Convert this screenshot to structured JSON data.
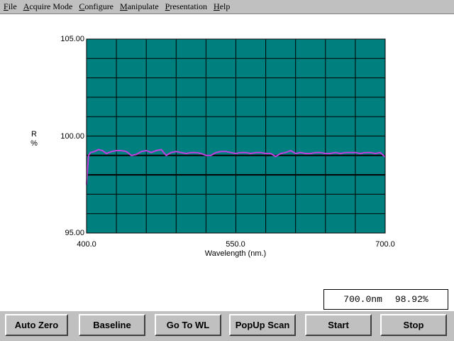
{
  "menu": {
    "items": [
      {
        "acc": "F",
        "rest": "ile"
      },
      {
        "acc": "A",
        "rest": "cquire Mode"
      },
      {
        "acc": "C",
        "rest": "onfigure"
      },
      {
        "acc": "M",
        "rest": "anipulate"
      },
      {
        "acc": "P",
        "rest": "resentation"
      },
      {
        "acc": "H",
        "rest": "elp"
      }
    ]
  },
  "readout": {
    "wavelength": "700.0nm",
    "value": "98.92%"
  },
  "buttons": [
    "Auto Zero",
    "Baseline",
    "Go To WL",
    "PopUp Scan",
    "Start",
    "Stop"
  ],
  "colors": {
    "plot_bg": "#007f7f",
    "grid": "#000000",
    "trace": "#c040e0",
    "button_face": "#c0c0c0"
  },
  "chart_data": {
    "type": "line",
    "xlabel": "Wavelength (nm.)",
    "ylabel": "R\n%",
    "xlim": [
      400,
      700
    ],
    "ylim": [
      95,
      105
    ],
    "x_tick_labels": [
      "400.0",
      "550.0",
      "700.0"
    ],
    "y_tick_labels": [
      "105.00",
      "100.00",
      "95.00"
    ],
    "grid": true,
    "grid_divisions": {
      "x": 10,
      "y": 10
    },
    "reference_lines": [
      99,
      98
    ],
    "series": [
      {
        "x": [
          400,
          401,
          402,
          404,
          408,
          412,
          416,
          420,
          425,
          430,
          435,
          440,
          445,
          450,
          455,
          460,
          465,
          470,
          475,
          480,
          485,
          490,
          495,
          500,
          505,
          510,
          515,
          520,
          525,
          530,
          535,
          540,
          545,
          550,
          555,
          560,
          565,
          570,
          575,
          580,
          585,
          590,
          595,
          600,
          605,
          610,
          615,
          620,
          625,
          630,
          635,
          640,
          645,
          650,
          655,
          660,
          665,
          670,
          675,
          680,
          685,
          690,
          695,
          700
        ],
        "values": [
          97.5,
          98.3,
          99.0,
          99.15,
          99.2,
          99.3,
          99.25,
          99.1,
          99.2,
          99.25,
          99.25,
          99.2,
          99.0,
          99.05,
          99.2,
          99.25,
          99.15,
          99.25,
          99.3,
          99.0,
          99.15,
          99.2,
          99.15,
          99.1,
          99.15,
          99.15,
          99.1,
          99.0,
          99.0,
          99.15,
          99.2,
          99.2,
          99.15,
          99.1,
          99.15,
          99.15,
          99.1,
          99.15,
          99.15,
          99.1,
          99.1,
          98.95,
          99.1,
          99.15,
          99.25,
          99.1,
          99.15,
          99.1,
          99.1,
          99.15,
          99.15,
          99.1,
          99.1,
          99.15,
          99.1,
          99.15,
          99.15,
          99.15,
          99.1,
          99.15,
          99.15,
          99.1,
          99.15,
          98.92
        ]
      }
    ]
  }
}
